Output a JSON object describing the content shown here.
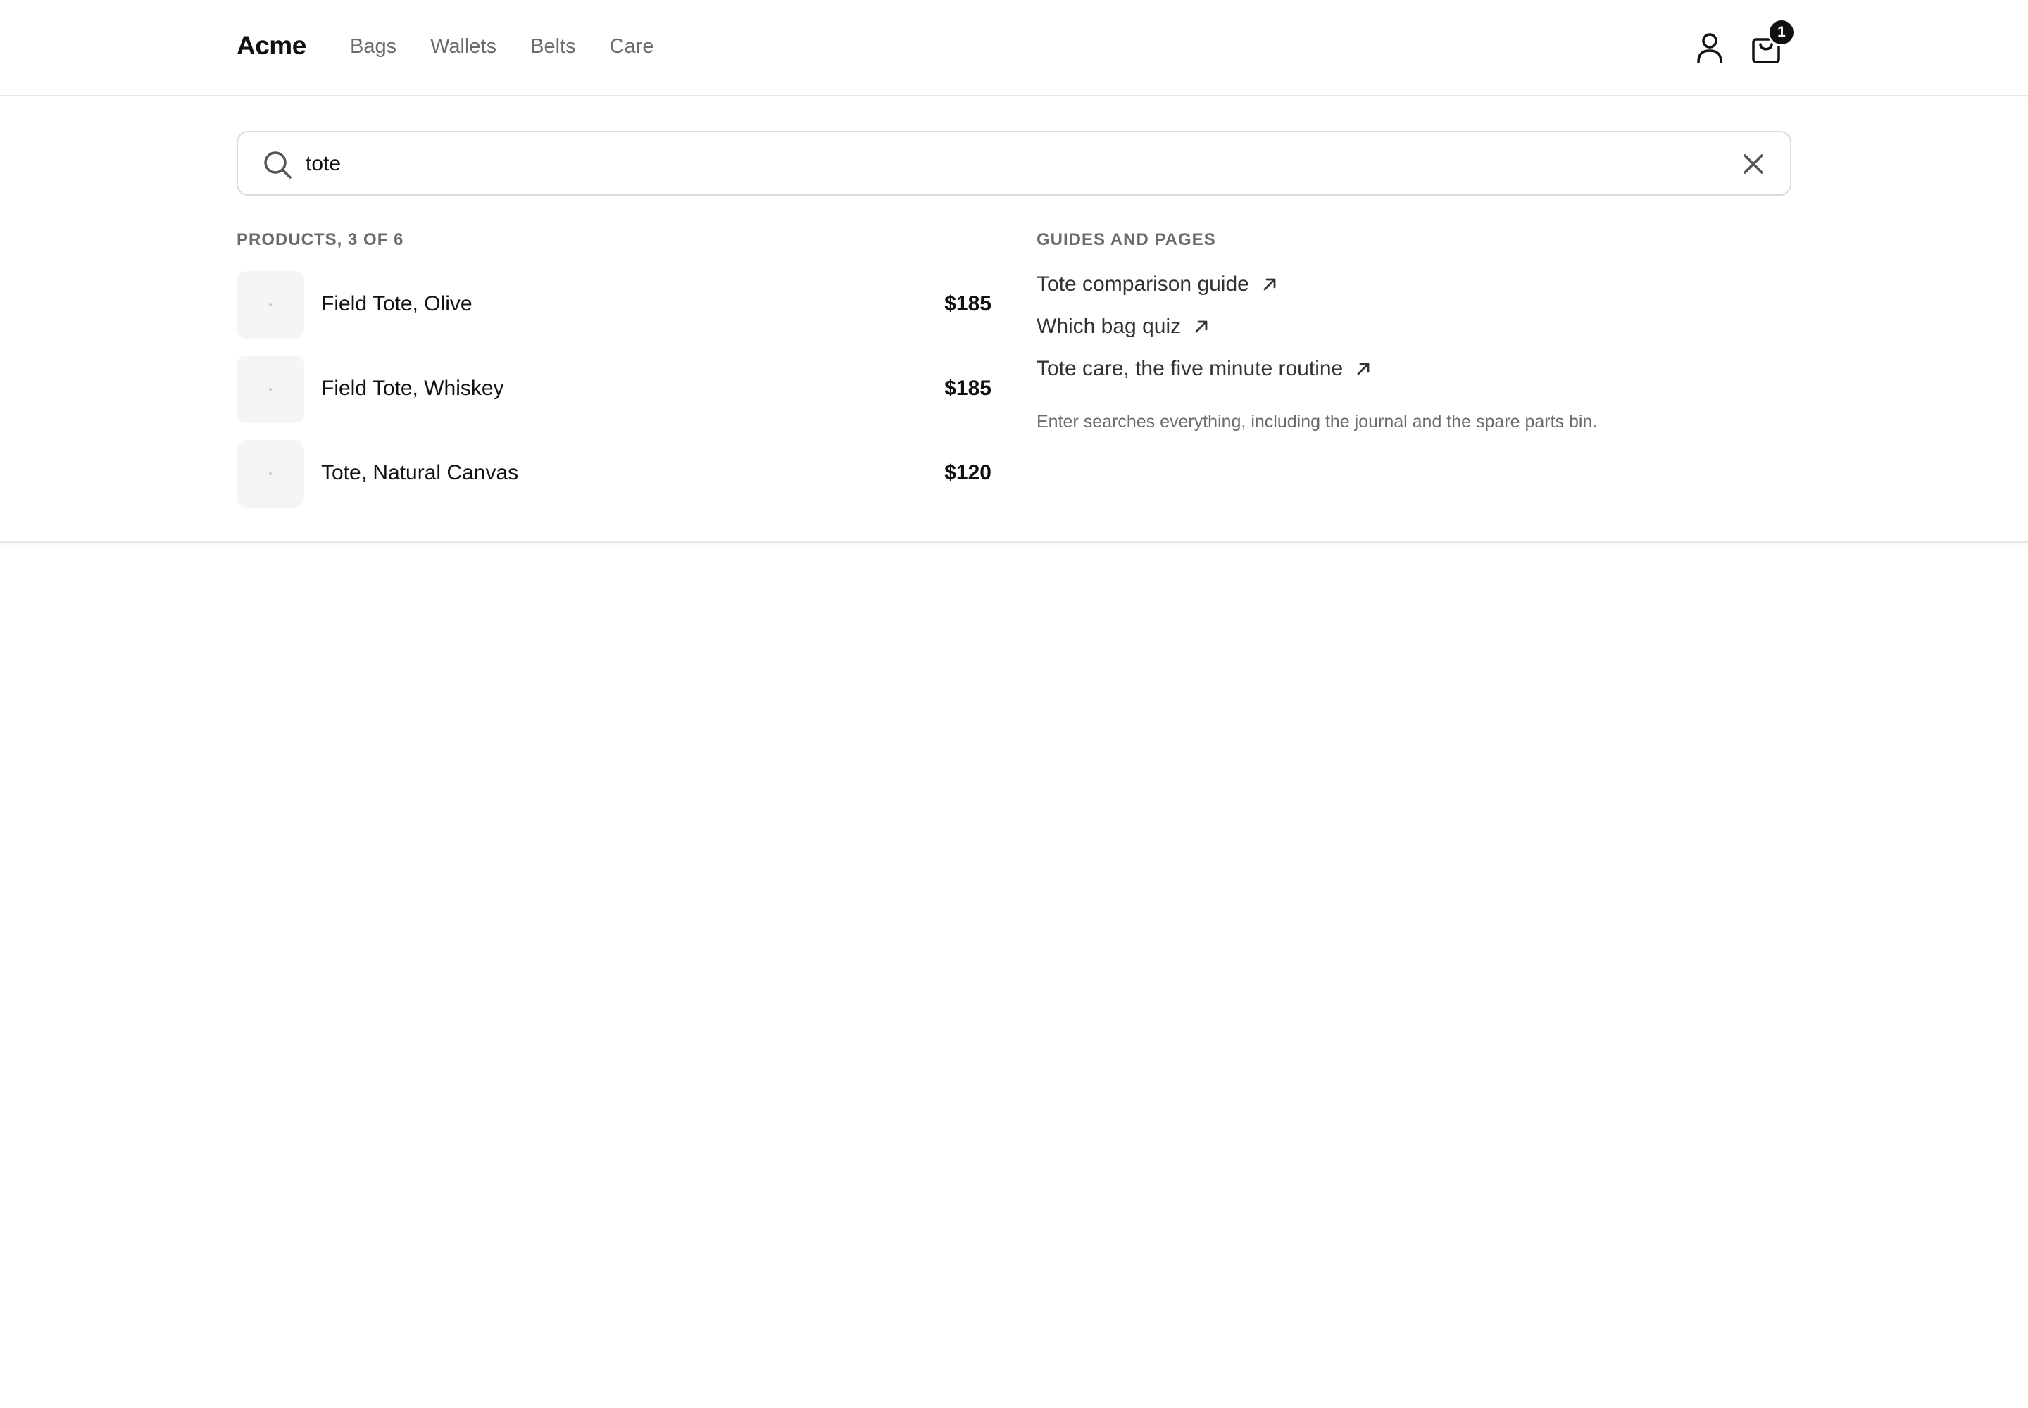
{
  "header": {
    "brand": "Acme",
    "nav": [
      "Bags",
      "Wallets",
      "Belts",
      "Care"
    ],
    "cart_count": "1"
  },
  "search": {
    "value": "tote",
    "placeholder": ""
  },
  "products": {
    "label": "PRODUCTS, 3 OF 6",
    "items": [
      {
        "name": "Field Tote, Olive",
        "price": "$185"
      },
      {
        "name": "Field Tote, Whiskey",
        "price": "$185"
      },
      {
        "name": "Tote, Natural Canvas",
        "price": "$120"
      }
    ]
  },
  "guides": {
    "label": "GUIDES AND PAGES",
    "items": [
      {
        "title": "Tote comparison guide",
        "icon": "external-arrow-icon"
      },
      {
        "title": "Which bag quiz",
        "icon": "external-arrow-icon"
      },
      {
        "title": "Tote care, the five minute routine",
        "icon": "external-arrow-icon"
      }
    ],
    "hint": "Enter searches everything, including the journal and the spare parts bin."
  },
  "icons": {
    "search": "search-icon",
    "clear": "close-icon",
    "account": "user-icon",
    "cart": "shopping-bag-icon"
  },
  "colors": {
    "text": "#111111",
    "muted": "#6b6b6b",
    "border": "#dcdcdc",
    "badge": "#111111"
  }
}
